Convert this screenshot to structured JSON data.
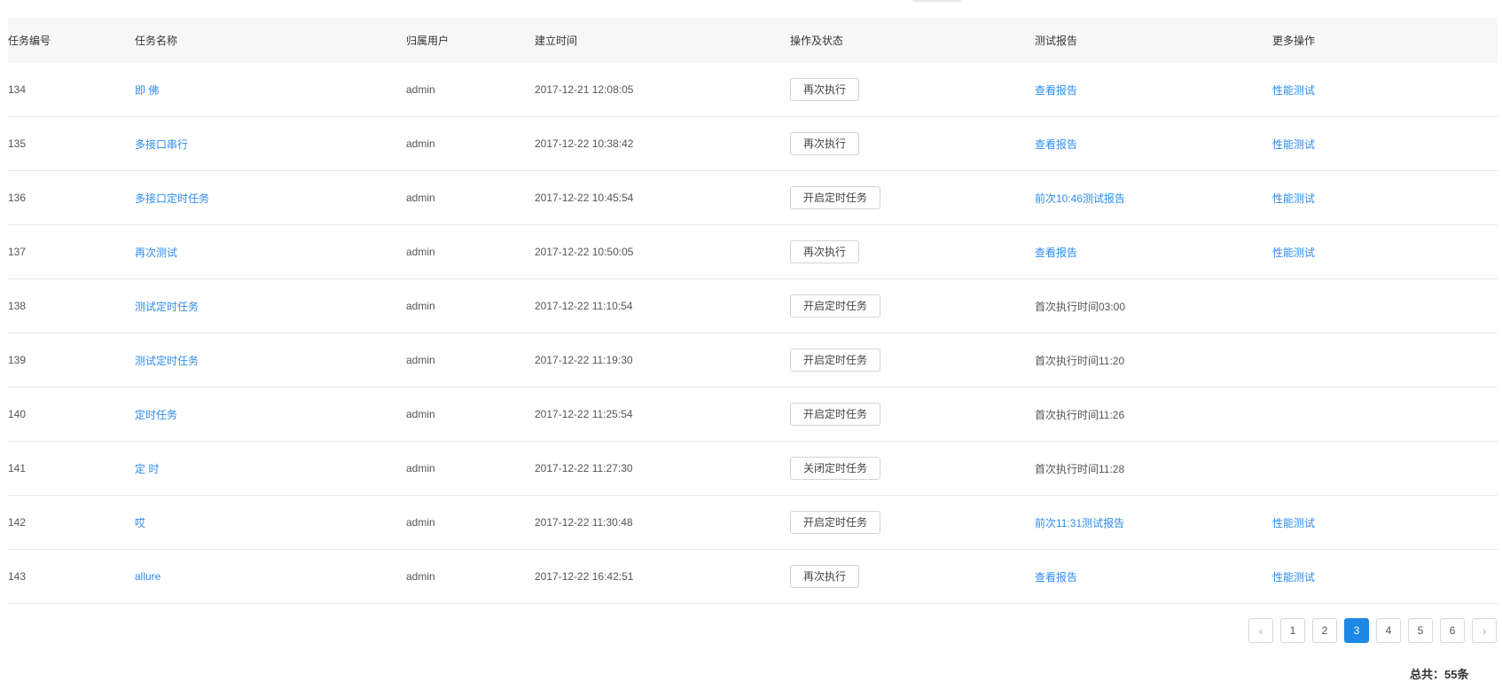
{
  "table": {
    "headers": {
      "id": "任务编号",
      "name": "任务名称",
      "user": "归属用户",
      "created": "建立时间",
      "ops": "操作及状态",
      "report": "测试报告",
      "more": "更多操作"
    },
    "rows": [
      {
        "id": "134",
        "name": "即 佛",
        "user": "admin",
        "created": "2017-12-21 12:08:05",
        "op": "再次执行",
        "report": "查看报告",
        "report_link": true,
        "more": "性能测试"
      },
      {
        "id": "135",
        "name": "多接口串行",
        "user": "admin",
        "created": "2017-12-22 10:38:42",
        "op": "再次执行",
        "report": "查看报告",
        "report_link": true,
        "more": "性能测试"
      },
      {
        "id": "136",
        "name": "多接口定时任务",
        "user": "admin",
        "created": "2017-12-22 10:45:54",
        "op": "开启定时任务",
        "report": "前次10:46测试报告",
        "report_link": true,
        "more": "性能测试"
      },
      {
        "id": "137",
        "name": "再次测试",
        "user": "admin",
        "created": "2017-12-22 10:50:05",
        "op": "再次执行",
        "report": "查看报告",
        "report_link": true,
        "more": "性能测试"
      },
      {
        "id": "138",
        "name": "测试定时任务",
        "user": "admin",
        "created": "2017-12-22 11:10:54",
        "op": "开启定时任务",
        "report": "首次执行时间03:00",
        "report_link": false,
        "more": ""
      },
      {
        "id": "139",
        "name": "测试定时任务",
        "user": "admin",
        "created": "2017-12-22 11:19:30",
        "op": "开启定时任务",
        "report": "首次执行时间11:20",
        "report_link": false,
        "more": ""
      },
      {
        "id": "140",
        "name": "定时任务",
        "user": "admin",
        "created": "2017-12-22 11:25:54",
        "op": "开启定时任务",
        "report": "首次执行时间11:26",
        "report_link": false,
        "more": ""
      },
      {
        "id": "141",
        "name": "定 时",
        "user": "admin",
        "created": "2017-12-22 11:27:30",
        "op": "关闭定时任务",
        "report": "首次执行时间11:28",
        "report_link": false,
        "more": ""
      },
      {
        "id": "142",
        "name": "哎",
        "user": "admin",
        "created": "2017-12-22 11:30:48",
        "op": "开启定时任务",
        "report": "前次11:31测试报告",
        "report_link": true,
        "more": "性能测试"
      },
      {
        "id": "143",
        "name": "allure",
        "user": "admin",
        "created": "2017-12-22 16:42:51",
        "op": "再次执行",
        "report": "查看报告",
        "report_link": true,
        "more": "性能测试"
      }
    ]
  },
  "pagination": {
    "prev_icon": "chevron-left-icon",
    "next_icon": "chevron-right-icon",
    "pages": [
      "1",
      "2",
      "3",
      "4",
      "5",
      "6"
    ],
    "current": "3",
    "total_text": "总共：55条"
  },
  "colors": {
    "link": "#2d8cf0",
    "active_page": "#1e88e5",
    "header_bg": "#f7f7f7"
  }
}
